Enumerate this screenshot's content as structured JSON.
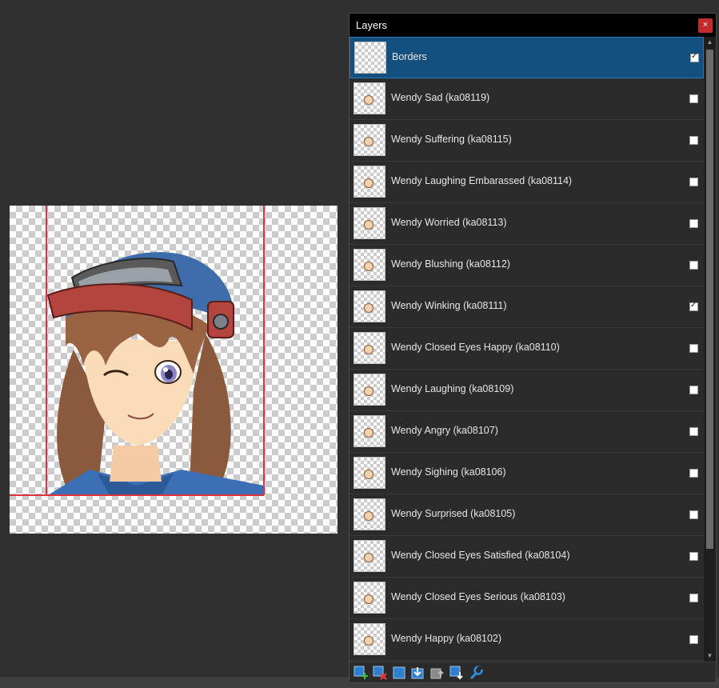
{
  "panel": {
    "title": "Layers",
    "close_label": "×"
  },
  "layers": [
    {
      "name": "Borders",
      "visible": true,
      "selected": true
    },
    {
      "name": "Wendy Sad (ka08119)",
      "visible": false,
      "selected": false
    },
    {
      "name": "Wendy Suffering (ka08115)",
      "visible": false,
      "selected": false
    },
    {
      "name": "Wendy Laughing Embarassed (ka08114)",
      "visible": false,
      "selected": false
    },
    {
      "name": "Wendy Worried (ka08113)",
      "visible": false,
      "selected": false
    },
    {
      "name": "Wendy Blushing (ka08112)",
      "visible": false,
      "selected": false
    },
    {
      "name": "Wendy Winking (ka08111)",
      "visible": true,
      "selected": false
    },
    {
      "name": "Wendy Closed Eyes Happy (ka08110)",
      "visible": false,
      "selected": false
    },
    {
      "name": "Wendy Laughing (ka08109)",
      "visible": false,
      "selected": false
    },
    {
      "name": "Wendy Angry (ka08107)",
      "visible": false,
      "selected": false
    },
    {
      "name": "Wendy Sighing (ka08106)",
      "visible": false,
      "selected": false
    },
    {
      "name": "Wendy Surprised (ka08105)",
      "visible": false,
      "selected": false
    },
    {
      "name": "Wendy Closed Eyes Satisfied (ka08104)",
      "visible": false,
      "selected": false
    },
    {
      "name": "Wendy Closed Eyes Serious (ka08103)",
      "visible": false,
      "selected": false
    },
    {
      "name": "Wendy Happy (ka08102)",
      "visible": false,
      "selected": false
    }
  ],
  "scroll": {
    "up_glyph": "▲",
    "down_glyph": "▼"
  },
  "toolbar": {
    "tools": [
      "add-layer-icon",
      "delete-layer-icon",
      "duplicate-layer-icon",
      "merge-layer-down-icon",
      "move-layer-up-icon",
      "move-layer-down-icon",
      "layer-properties-icon"
    ]
  },
  "colors": {
    "selected_row": "#14507f",
    "border_guide": "#e0323a",
    "close_button": "#c42b2b",
    "tool_accent": "#2f7fd0"
  }
}
